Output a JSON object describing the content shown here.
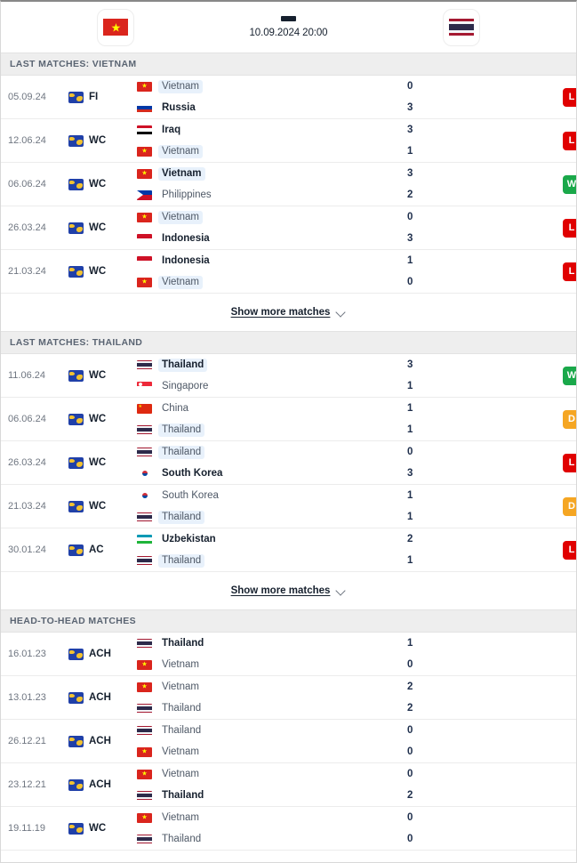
{
  "header": {
    "home_team": "Vietnam",
    "home_flag": "vietnam",
    "away_team": "Thailand",
    "away_flag": "thailand",
    "separator": "-",
    "kickoff": "10.09.2024 20:00"
  },
  "colors": {
    "win": "#1aa84a",
    "loss": "#e00000",
    "draw": "#f5a623",
    "section_bg": "#eeeeee",
    "highlight_bg": "#e8f1fb"
  },
  "show_more_label": "Show more matches",
  "sections": [
    {
      "title": "LAST MATCHES: VIETNAM",
      "has_show_more": true,
      "has_badges": true,
      "rows": [
        {
          "date": "05.09.24",
          "competition": "FI",
          "home": {
            "name": "Vietnam",
            "flag": "vietnam",
            "bold": false,
            "highlight": true
          },
          "away": {
            "name": "Russia",
            "flag": "russia",
            "bold": true,
            "highlight": false
          },
          "home_score": "0",
          "away_score": "3",
          "result": "L"
        },
        {
          "date": "12.06.24",
          "competition": "WC",
          "home": {
            "name": "Iraq",
            "flag": "iraq",
            "bold": true,
            "highlight": false
          },
          "away": {
            "name": "Vietnam",
            "flag": "vietnam",
            "bold": false,
            "highlight": true
          },
          "home_score": "3",
          "away_score": "1",
          "result": "L"
        },
        {
          "date": "06.06.24",
          "competition": "WC",
          "home": {
            "name": "Vietnam",
            "flag": "vietnam",
            "bold": true,
            "highlight": true
          },
          "away": {
            "name": "Philippines",
            "flag": "philippines",
            "bold": false,
            "highlight": false
          },
          "home_score": "3",
          "away_score": "2",
          "result": "W"
        },
        {
          "date": "26.03.24",
          "competition": "WC",
          "home": {
            "name": "Vietnam",
            "flag": "vietnam",
            "bold": false,
            "highlight": true
          },
          "away": {
            "name": "Indonesia",
            "flag": "indonesia",
            "bold": true,
            "highlight": false
          },
          "home_score": "0",
          "away_score": "3",
          "result": "L"
        },
        {
          "date": "21.03.24",
          "competition": "WC",
          "home": {
            "name": "Indonesia",
            "flag": "indonesia",
            "bold": true,
            "highlight": false
          },
          "away": {
            "name": "Vietnam",
            "flag": "vietnam",
            "bold": false,
            "highlight": true
          },
          "home_score": "1",
          "away_score": "0",
          "result": "L"
        }
      ]
    },
    {
      "title": "LAST MATCHES: THAILAND",
      "has_show_more": true,
      "has_badges": true,
      "rows": [
        {
          "date": "11.06.24",
          "competition": "WC",
          "home": {
            "name": "Thailand",
            "flag": "thailand",
            "bold": true,
            "highlight": true
          },
          "away": {
            "name": "Singapore",
            "flag": "singapore",
            "bold": false,
            "highlight": false
          },
          "home_score": "3",
          "away_score": "1",
          "result": "W"
        },
        {
          "date": "06.06.24",
          "competition": "WC",
          "home": {
            "name": "China",
            "flag": "china",
            "bold": false,
            "highlight": false
          },
          "away": {
            "name": "Thailand",
            "flag": "thailand",
            "bold": false,
            "highlight": true
          },
          "home_score": "1",
          "away_score": "1",
          "result": "D"
        },
        {
          "date": "26.03.24",
          "competition": "WC",
          "home": {
            "name": "Thailand",
            "flag": "thailand",
            "bold": false,
            "highlight": true
          },
          "away": {
            "name": "South Korea",
            "flag": "southkorea",
            "bold": true,
            "highlight": false
          },
          "home_score": "0",
          "away_score": "3",
          "result": "L"
        },
        {
          "date": "21.03.24",
          "competition": "WC",
          "home": {
            "name": "South Korea",
            "flag": "southkorea",
            "bold": false,
            "highlight": false
          },
          "away": {
            "name": "Thailand",
            "flag": "thailand",
            "bold": false,
            "highlight": true
          },
          "home_score": "1",
          "away_score": "1",
          "result": "D"
        },
        {
          "date": "30.01.24",
          "competition": "AC",
          "home": {
            "name": "Uzbekistan",
            "flag": "uzbekistan",
            "bold": true,
            "highlight": false
          },
          "away": {
            "name": "Thailand",
            "flag": "thailand",
            "bold": false,
            "highlight": true
          },
          "home_score": "2",
          "away_score": "1",
          "result": "L"
        }
      ]
    },
    {
      "title": "HEAD-TO-HEAD MATCHES",
      "has_show_more": false,
      "has_badges": false,
      "rows": [
        {
          "date": "16.01.23",
          "competition": "ACH",
          "home": {
            "name": "Thailand",
            "flag": "thailand",
            "bold": true,
            "highlight": false
          },
          "away": {
            "name": "Vietnam",
            "flag": "vietnam",
            "bold": false,
            "highlight": false
          },
          "home_score": "1",
          "away_score": "0",
          "result": ""
        },
        {
          "date": "13.01.23",
          "competition": "ACH",
          "home": {
            "name": "Vietnam",
            "flag": "vietnam",
            "bold": false,
            "highlight": false
          },
          "away": {
            "name": "Thailand",
            "flag": "thailand",
            "bold": false,
            "highlight": false
          },
          "home_score": "2",
          "away_score": "2",
          "result": ""
        },
        {
          "date": "26.12.21",
          "competition": "ACH",
          "home": {
            "name": "Thailand",
            "flag": "thailand",
            "bold": false,
            "highlight": false
          },
          "away": {
            "name": "Vietnam",
            "flag": "vietnam",
            "bold": false,
            "highlight": false
          },
          "home_score": "0",
          "away_score": "0",
          "result": ""
        },
        {
          "date": "23.12.21",
          "competition": "ACH",
          "home": {
            "name": "Vietnam",
            "flag": "vietnam",
            "bold": false,
            "highlight": false
          },
          "away": {
            "name": "Thailand",
            "flag": "thailand",
            "bold": true,
            "highlight": false
          },
          "home_score": "0",
          "away_score": "2",
          "result": ""
        },
        {
          "date": "19.11.19",
          "competition": "WC",
          "home": {
            "name": "Vietnam",
            "flag": "vietnam",
            "bold": false,
            "highlight": false
          },
          "away": {
            "name": "Thailand",
            "flag": "thailand",
            "bold": false,
            "highlight": false
          },
          "home_score": "0",
          "away_score": "0",
          "result": ""
        }
      ]
    }
  ]
}
